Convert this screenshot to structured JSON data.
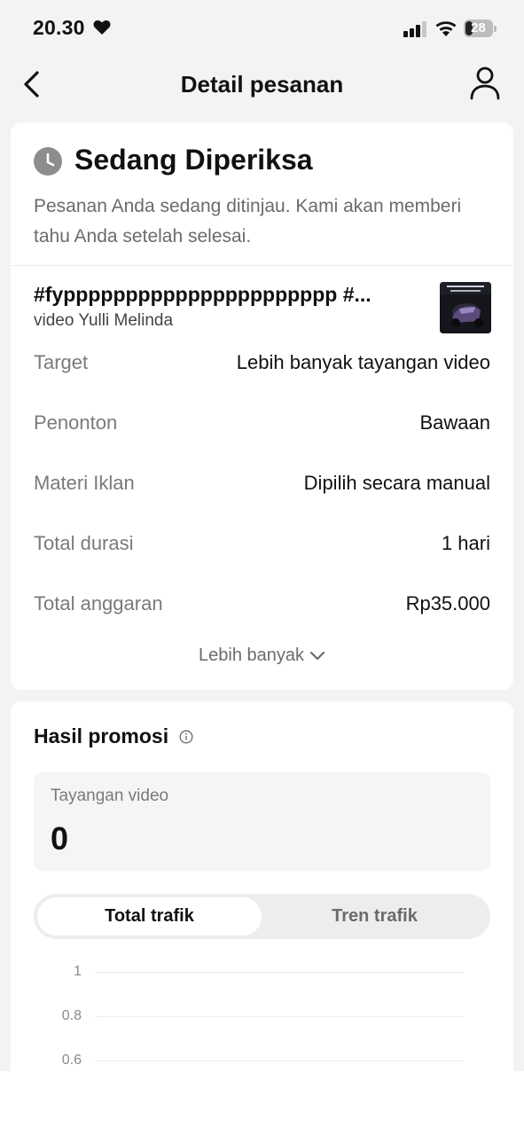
{
  "status_bar": {
    "time": "20.30",
    "battery": "28"
  },
  "nav": {
    "title": "Detail pesanan"
  },
  "order": {
    "status_title": "Sedang Diperiksa",
    "status_description": "Pesanan Anda sedang ditinjau. Kami akan memberi tahu Anda setelah selesai.",
    "video_title": "#fypppppppppppppppppppppp #...",
    "video_author": "video Yulli Melinda",
    "details": [
      {
        "label": "Target",
        "value": "Lebih banyak tayangan video"
      },
      {
        "label": "Penonton",
        "value": "Bawaan"
      },
      {
        "label": "Materi Iklan",
        "value": "Dipilih secara manual"
      },
      {
        "label": "Total durasi",
        "value": "1 hari"
      },
      {
        "label": "Total anggaran",
        "value": "Rp35.000"
      }
    ],
    "more_label": "Lebih banyak"
  },
  "results": {
    "title": "Hasil promosi",
    "metric_label": "Tayangan video",
    "metric_value": "0",
    "tabs": [
      {
        "label": "Total trafik",
        "active": true
      },
      {
        "label": "Tren trafik",
        "active": false
      }
    ],
    "y_ticks": [
      "1",
      "0.8",
      "0.6"
    ]
  },
  "icons": {
    "back": "chevron-left-icon",
    "profile": "person-icon",
    "status": "clock-icon",
    "info": "info-icon",
    "more": "chevron-down-icon"
  }
}
